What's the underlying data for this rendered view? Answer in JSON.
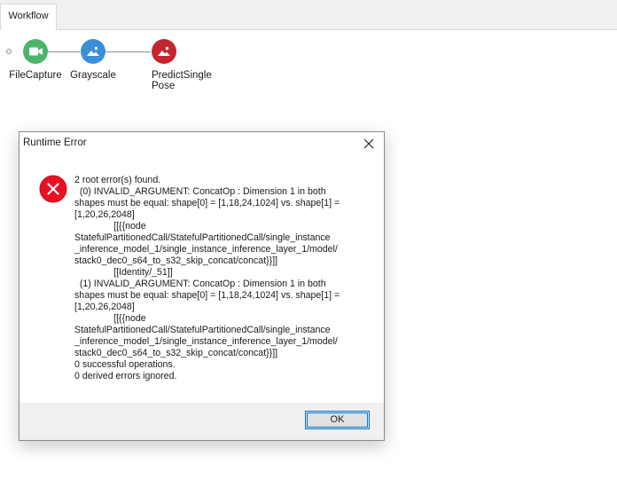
{
  "tabs": [
    {
      "label": "Workflow"
    }
  ],
  "workflow": {
    "nodes": [
      {
        "label": "FileCapture",
        "icon": "video-camera-icon",
        "color": "#4cb56c"
      },
      {
        "label": "Grayscale",
        "icon": "image-icon",
        "color": "#3b8fd9"
      },
      {
        "label": "PredictSingle\nPose",
        "icon": "image-icon",
        "color": "#c3262e"
      }
    ]
  },
  "dialog": {
    "title": "Runtime Error",
    "icon": "error-icon",
    "message": "2 root error(s) found.\n  (0) INVALID_ARGUMENT: ConcatOp : Dimension 1 in both\nshapes must be equal: shape[0] = [1,18,24,1024] vs. shape[1] =\n[1,20,26,2048]\n               [[{{node\nStatefulPartitionedCall/StatefulPartitionedCall/single_instance\n_inference_model_1/single_instance_inference_layer_1/model/\nstack0_dec0_s64_to_s32_skip_concat/concat}}]]\n               [[Identity/_51]]\n  (1) INVALID_ARGUMENT: ConcatOp : Dimension 1 in both\nshapes must be equal: shape[0] = [1,18,24,1024] vs. shape[1] =\n[1,20,26,2048]\n               [[{{node\nStatefulPartitionedCall/StatefulPartitionedCall/single_instance\n_inference_model_1/single_instance_inference_layer_1/model/\nstack0_dec0_s64_to_s32_skip_concat/concat}}]]\n0 successful operations.\n0 derived errors ignored.",
    "ok_label": "OK"
  }
}
